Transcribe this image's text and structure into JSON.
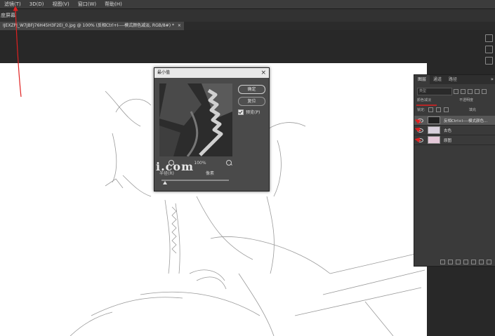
{
  "menubar": {
    "items": [
      "滤镜(T)",
      "3D(D)",
      "视图(V)",
      "窗口(W)",
      "帮助(H)"
    ]
  },
  "left_label": "度屏幕",
  "document_tab": {
    "label": "IJEXZPJ_W7JBFJ76H45H3F2EI_0.jpg @ 100% (反相Ctrl+I----模式颜色减淡, RGB/8#) *",
    "close": "×"
  },
  "dialog": {
    "title": "最小值",
    "close": "×",
    "ok_label": "确定",
    "reset_label": "复位",
    "preview_label": "预览(P)",
    "zoom_level": "100%",
    "watermark": "i.com",
    "radius_label": "半径(R)",
    "radius_unit": "像素",
    "radius_fraction": 0.05
  },
  "layers_panel": {
    "tabs": [
      "图层",
      "通道",
      "路径"
    ],
    "menu_icon": "»",
    "search_placeholder": "类型",
    "blend_mode": "颜色减淡",
    "opacity": "不透明度",
    "lock_label": "锁定:",
    "fill_label": "填充",
    "layers": [
      {
        "name": "反相Ctrl+I----模式颜色...",
        "selected": true,
        "thumb": "#222222"
      },
      {
        "name": "去色",
        "selected": false,
        "thumb": "#d8d0dc"
      },
      {
        "name": "原图",
        "selected": false,
        "thumb": "#e4c8d8"
      }
    ]
  },
  "colors": {
    "annotation_red": "#e02020",
    "panel_bg": "#3a3a3a",
    "canvas_bg": "#ffffff"
  }
}
